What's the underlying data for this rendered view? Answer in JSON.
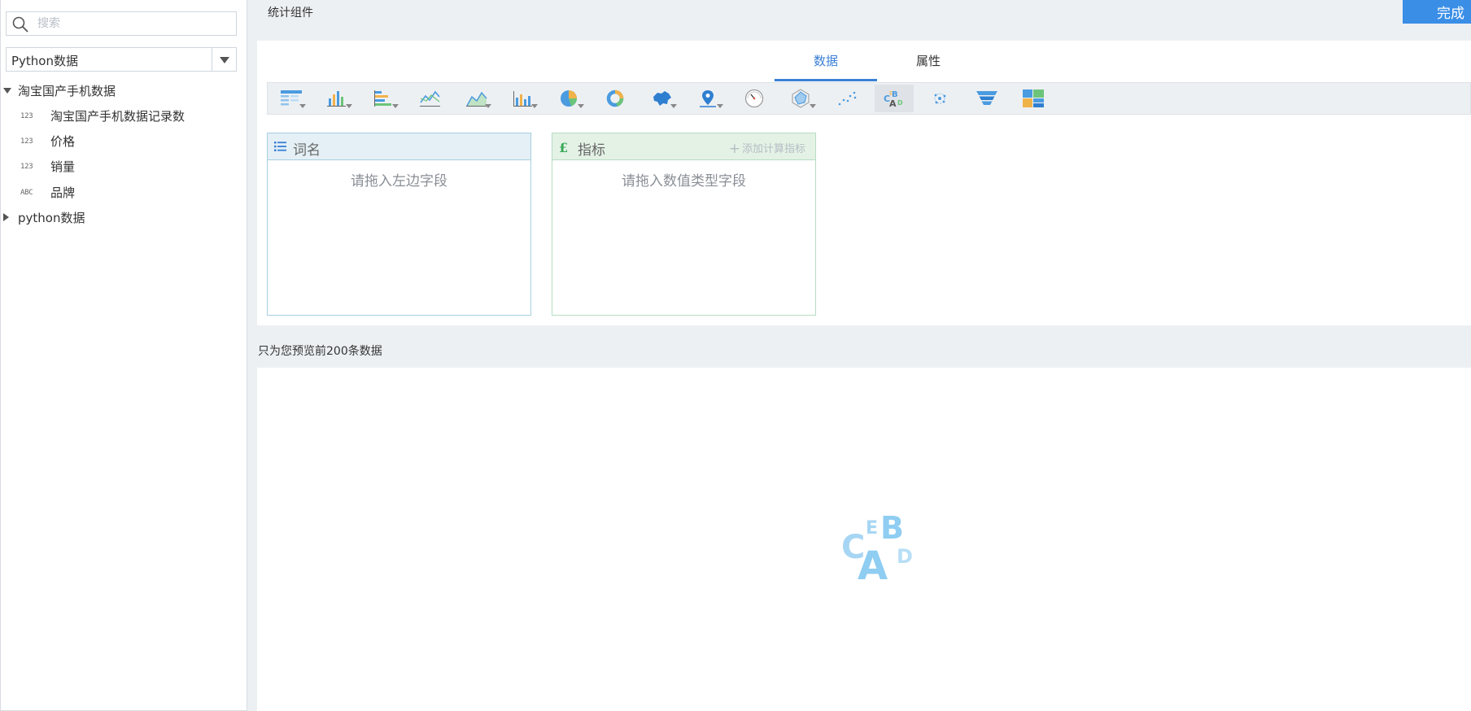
{
  "sidebar": {
    "search": {
      "placeholder": "搜索"
    },
    "source_select": {
      "value": "Python数据"
    },
    "tree": {
      "root": {
        "label": "淘宝国产手机数据",
        "expanded": true
      },
      "fields": [
        {
          "type": "123",
          "label": "淘宝国产手机数据记录数"
        },
        {
          "type": "123",
          "label": "价格"
        },
        {
          "type": "123",
          "label": "销量"
        },
        {
          "type": "ABC",
          "label": "品牌"
        }
      ],
      "collapsed_group": {
        "label": "python数据",
        "expanded": false
      }
    }
  },
  "header": {
    "title": "统计组件",
    "done_label": "完成"
  },
  "tabs": {
    "data_label": "数据",
    "props_label": "属性",
    "active": "data"
  },
  "chart_types": [
    {
      "icon": "table-chart-icon",
      "has_dropdown": true
    },
    {
      "icon": "bar-chart-icon",
      "has_dropdown": true
    },
    {
      "icon": "horizontal-bar-chart-icon",
      "has_dropdown": true
    },
    {
      "icon": "line-chart-icon",
      "has_dropdown": false
    },
    {
      "icon": "area-chart-icon",
      "has_dropdown": true
    },
    {
      "icon": "combo-chart-icon",
      "has_dropdown": true
    },
    {
      "icon": "pie-chart-icon",
      "has_dropdown": true
    },
    {
      "icon": "donut-chart-icon",
      "has_dropdown": false
    },
    {
      "icon": "region-map-icon",
      "has_dropdown": true
    },
    {
      "icon": "point-map-icon",
      "has_dropdown": true
    },
    {
      "icon": "gauge-chart-icon",
      "has_dropdown": false
    },
    {
      "icon": "radar-chart-icon",
      "has_dropdown": true
    },
    {
      "icon": "scatter-chart-icon",
      "has_dropdown": false
    },
    {
      "icon": "word-cloud-icon",
      "has_dropdown": false,
      "selected": true
    },
    {
      "icon": "force-graph-icon",
      "has_dropdown": false
    },
    {
      "icon": "funnel-chart-icon",
      "has_dropdown": false
    },
    {
      "icon": "treemap-chart-icon",
      "has_dropdown": false
    }
  ],
  "dimension_box": {
    "label": "词名",
    "hint": "请拖入左边字段"
  },
  "metric_box": {
    "label": "指标",
    "add_calc_label": "添加计算指标",
    "hint": "请拖入数值类型字段"
  },
  "preview": {
    "note": "只为您预览前200条数据",
    "placeholder_letters": [
      "C",
      "E",
      "B",
      "A",
      "D"
    ]
  },
  "colors": {
    "accent": "#3a7fd5",
    "done_button": "#3a8ee6",
    "dimension_header": "#e4f0f6",
    "metric_header": "#e4f2e6",
    "wordcloud_blue": "#8fcdf2"
  }
}
